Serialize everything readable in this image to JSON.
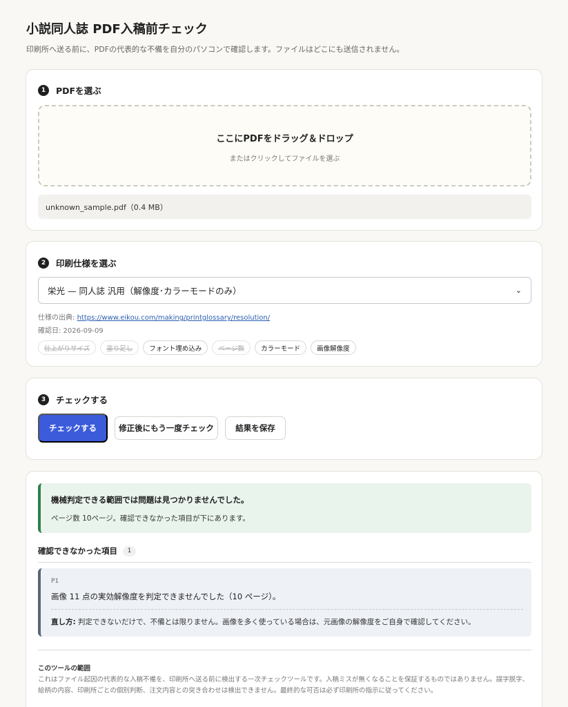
{
  "header": {
    "title": "小説同人誌 PDF入稿前チェック",
    "description": "印刷所へ送る前に、PDFの代表的な不備を自分のパソコンで確認します。ファイルはどこにも送信されません。"
  },
  "step1": {
    "number": "1",
    "title": "PDFを選ぶ",
    "dropzone_title": "ここにPDFをドラッグ＆ドロップ",
    "dropzone_sub": "またはクリックしてファイルを選ぶ",
    "file_info": "unknown_sample.pdf（0.4 MB）"
  },
  "step2": {
    "number": "2",
    "title": "印刷仕様を選ぶ",
    "selected_spec": "栄光 — 同人誌 汎用（解像度･カラーモードのみ）",
    "source_label": "仕様の出典: ",
    "source_url": "https://www.eikou.com/making/printglossary/resolution/",
    "checked_date": "確認日: 2026-09-09",
    "tags": [
      {
        "label": "仕上がりサイズ",
        "enabled": false
      },
      {
        "label": "塗り足し",
        "enabled": false
      },
      {
        "label": "フォント埋め込み",
        "enabled": true
      },
      {
        "label": "ページ数",
        "enabled": false
      },
      {
        "label": "カラーモード",
        "enabled": true
      },
      {
        "label": "画像解像度",
        "enabled": true
      }
    ]
  },
  "step3": {
    "number": "3",
    "title": "チェックする",
    "check_button": "チェックする",
    "recheck_button": "修正後にもう一度チェック",
    "save_button": "結果を保存"
  },
  "results": {
    "ok_title": "機械判定できる範囲では問題は見つかりませんでした。",
    "ok_sub": "ページ数 10ページ。確認できなかった項目が下にあります。",
    "unchecked_title": "確認できなかった項目",
    "unchecked_count": "1",
    "issues": [
      {
        "page": "P1",
        "message": "画像 11 点の実効解像度を判定できませんでした（10 ページ）。",
        "fix_label": "直し方:",
        "fix_text": " 判定できないだけで、不備とは限りません。画像を多く使っている場合は、元画像の解像度をご自身で確認してください。"
      }
    ],
    "scope_title": "このツールの範囲",
    "scope_text": "これはファイル起因の代表的な入稿不備を、印刷所へ送る前に検出する一次チェックツールです。入稿ミスが無くなることを保証するものではありません。誤字脱字、絵柄の内容、印刷所ごとの個別判断、注文内容との突き合わせは検出できません。最終的な可否は必ず印刷所の指示に従ってください。"
  },
  "colors": {
    "primary": "#3b5bdb",
    "success_border": "#2f7d4a",
    "success_bg": "#e9f4ec",
    "issue_border": "#5a6675",
    "issue_bg": "#eef1f6"
  }
}
